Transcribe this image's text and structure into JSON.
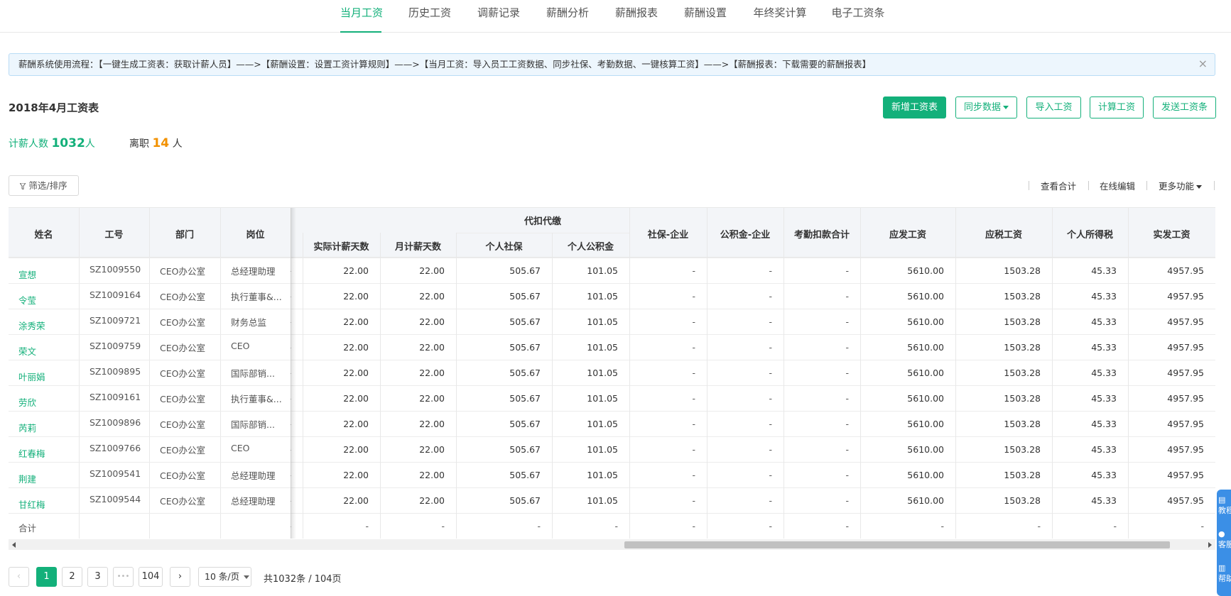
{
  "nav": {
    "tabs": [
      "当月工资",
      "历史工资",
      "调薪记录",
      "薪酬分析",
      "薪酬报表",
      "薪酬设置",
      "年终奖计算",
      "电子工资条"
    ],
    "active_index": 0
  },
  "alert": {
    "text": "薪酬系统使用流程：【一键生成工资表：获取计薪人员】——>【薪酬设置：设置工资计算规则】——>【当月工资：导入员工工资数据、同步社保、考勤数据、一键核算工资】——>【薪酬报表：下载需要的薪酬报表】",
    "close": "×"
  },
  "page_title": "2018年4月工资表",
  "actions": {
    "new": "新增工资表",
    "sync": "同步数据",
    "import": "导入工资",
    "calc": "计算工资",
    "send": "发送工资条"
  },
  "stats": {
    "paid_label": "计薪人数",
    "paid_count": "1032",
    "paid_unit": "人",
    "left_label": "离职",
    "left_count": "14",
    "left_unit": "人"
  },
  "toolbar": {
    "filter": "筛选/排序",
    "view_total": "查看合计",
    "online_edit": "在线编辑",
    "more": "更多功能"
  },
  "table": {
    "headers": {
      "name": "姓名",
      "id": "工号",
      "dept": "部门",
      "position": "岗位",
      "withholding_group": "代扣代缴",
      "actual_days": "实际计薪天数",
      "month_days": "月计薪天数",
      "personal_si": "个人社保",
      "personal_hf": "个人公积金",
      "si_company": "社保-企业",
      "hf_company": "公积金-企业",
      "attendance_deduct": "考勤扣款合计",
      "gross_pay": "应发工资",
      "taxable_pay": "应税工资",
      "income_tax": "个人所得税",
      "net_pay": "实发工资"
    },
    "rows": [
      {
        "name": "宣想",
        "id": "SZ1009550",
        "dept": "CEO办公室",
        "position": "总经理助理",
        "hidden": "-",
        "actual_days": "22.00",
        "month_days": "22.00",
        "personal_si": "505.67",
        "personal_hf": "101.05",
        "si_company": "-",
        "hf_company": "-",
        "attendance_deduct": "-",
        "gross_pay": "5610.00",
        "taxable_pay": "1503.28",
        "income_tax": "45.33",
        "net_pay": "4957.95"
      },
      {
        "name": "令莹",
        "id": "SZ1009164",
        "dept": "CEO办公室",
        "position": "执行董事&...",
        "hidden": "-",
        "actual_days": "22.00",
        "month_days": "22.00",
        "personal_si": "505.67",
        "personal_hf": "101.05",
        "si_company": "-",
        "hf_company": "-",
        "attendance_deduct": "-",
        "gross_pay": "5610.00",
        "taxable_pay": "1503.28",
        "income_tax": "45.33",
        "net_pay": "4957.95"
      },
      {
        "name": "涂秀荣",
        "id": "SZ1009721",
        "dept": "CEO办公室",
        "position": "财务总监",
        "hidden": "-",
        "actual_days": "22.00",
        "month_days": "22.00",
        "personal_si": "505.67",
        "personal_hf": "101.05",
        "si_company": "-",
        "hf_company": "-",
        "attendance_deduct": "-",
        "gross_pay": "5610.00",
        "taxable_pay": "1503.28",
        "income_tax": "45.33",
        "net_pay": "4957.95"
      },
      {
        "name": "荣文",
        "id": "SZ1009759",
        "dept": "CEO办公室",
        "position": "CEO",
        "hidden": "-",
        "actual_days": "22.00",
        "month_days": "22.00",
        "personal_si": "505.67",
        "personal_hf": "101.05",
        "si_company": "-",
        "hf_company": "-",
        "attendance_deduct": "-",
        "gross_pay": "5610.00",
        "taxable_pay": "1503.28",
        "income_tax": "45.33",
        "net_pay": "4957.95"
      },
      {
        "name": "叶丽娟",
        "id": "SZ1009895",
        "dept": "CEO办公室",
        "position": "国际部销...",
        "hidden": "-",
        "actual_days": "22.00",
        "month_days": "22.00",
        "personal_si": "505.67",
        "personal_hf": "101.05",
        "si_company": "-",
        "hf_company": "-",
        "attendance_deduct": "-",
        "gross_pay": "5610.00",
        "taxable_pay": "1503.28",
        "income_tax": "45.33",
        "net_pay": "4957.95"
      },
      {
        "name": "劳欣",
        "id": "SZ1009161",
        "dept": "CEO办公室",
        "position": "执行董事&...",
        "hidden": "-",
        "actual_days": "22.00",
        "month_days": "22.00",
        "personal_si": "505.67",
        "personal_hf": "101.05",
        "si_company": "-",
        "hf_company": "-",
        "attendance_deduct": "-",
        "gross_pay": "5610.00",
        "taxable_pay": "1503.28",
        "income_tax": "45.33",
        "net_pay": "4957.95"
      },
      {
        "name": "芮莉",
        "id": "SZ1009896",
        "dept": "CEO办公室",
        "position": "国际部销...",
        "hidden": "-",
        "actual_days": "22.00",
        "month_days": "22.00",
        "personal_si": "505.67",
        "personal_hf": "101.05",
        "si_company": "-",
        "hf_company": "-",
        "attendance_deduct": "-",
        "gross_pay": "5610.00",
        "taxable_pay": "1503.28",
        "income_tax": "45.33",
        "net_pay": "4957.95"
      },
      {
        "name": "红春梅",
        "id": "SZ1009766",
        "dept": "CEO办公室",
        "position": "CEO",
        "hidden": "-",
        "actual_days": "22.00",
        "month_days": "22.00",
        "personal_si": "505.67",
        "personal_hf": "101.05",
        "si_company": "-",
        "hf_company": "-",
        "attendance_deduct": "-",
        "gross_pay": "5610.00",
        "taxable_pay": "1503.28",
        "income_tax": "45.33",
        "net_pay": "4957.95"
      },
      {
        "name": "荆建",
        "id": "SZ1009541",
        "dept": "CEO办公室",
        "position": "总经理助理",
        "hidden": "-",
        "actual_days": "22.00",
        "month_days": "22.00",
        "personal_si": "505.67",
        "personal_hf": "101.05",
        "si_company": "-",
        "hf_company": "-",
        "attendance_deduct": "-",
        "gross_pay": "5610.00",
        "taxable_pay": "1503.28",
        "income_tax": "45.33",
        "net_pay": "4957.95"
      },
      {
        "name": "甘红梅",
        "id": "SZ1009544",
        "dept": "CEO办公室",
        "position": "总经理助理",
        "hidden": "-",
        "actual_days": "22.00",
        "month_days": "22.00",
        "personal_si": "505.67",
        "personal_hf": "101.05",
        "si_company": "-",
        "hf_company": "-",
        "attendance_deduct": "-",
        "gross_pay": "5610.00",
        "taxable_pay": "1503.28",
        "income_tax": "45.33",
        "net_pay": "4957.95"
      }
    ],
    "total_row": {
      "label": "合计",
      "dash": "-"
    }
  },
  "pagination": {
    "prev": "‹",
    "pages": [
      "1",
      "2",
      "3"
    ],
    "ellipsis": "•••",
    "last": "104",
    "next": "›",
    "page_size": "10 条/页",
    "total": "共1032条 / 104页"
  },
  "float_tools": [
    "教程",
    "客服",
    "帮助"
  ],
  "colors": {
    "accent": "#13b07a",
    "stat_orange": "#f29100",
    "alert_bg": "#edf6fd",
    "float_blue": "#3b8fe6"
  }
}
